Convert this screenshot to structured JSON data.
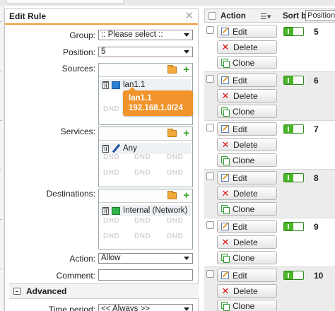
{
  "edit_panel": {
    "title": "Edit Rule",
    "group": {
      "label": "Group:",
      "value": ":: Please select ::"
    },
    "position": {
      "label": "Position:",
      "value": "5"
    },
    "sources": {
      "label": "Sources:",
      "item": "lan1.1",
      "tooltip_name": "lan1.1",
      "tooltip_addr": "192.168.1.0/24"
    },
    "services": {
      "label": "Services:",
      "item": "Any"
    },
    "destinations": {
      "label": "Destinations:",
      "item": "Internal (Network)"
    },
    "dnd": "DND",
    "action": {
      "label": "Action:",
      "value": "Allow"
    },
    "comment": {
      "label": "Comment:",
      "value": ""
    },
    "advanced": {
      "label": "Advanced"
    },
    "time_period": {
      "label": "Time period:",
      "value": "<< Always >>"
    }
  },
  "list": {
    "header": {
      "action": "Action",
      "sort_by": "Sort by:",
      "sort_value": "Position"
    },
    "buttons": {
      "edit": "Edit",
      "delete": "Delete",
      "clone": "Clone"
    },
    "rows": [
      {
        "position": "5"
      },
      {
        "position": "6"
      },
      {
        "position": "7"
      },
      {
        "position": "8"
      },
      {
        "position": "9"
      },
      {
        "position": "10"
      }
    ]
  },
  "colors": {
    "accent": "#f19a2c",
    "toggle_on": "#49b527",
    "delete": "#dd1111"
  }
}
